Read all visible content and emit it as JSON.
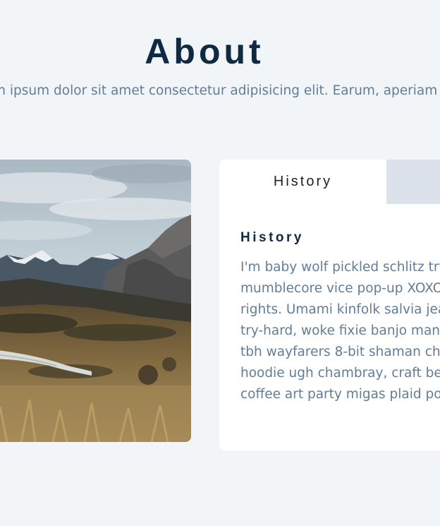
{
  "section": {
    "title": "About",
    "subtitle": "m ipsum dolor sit amet consectetur adipisicing elit. Earum, aperiam"
  },
  "image": {
    "icon": "mountain-landscape-photo"
  },
  "tabs": [
    {
      "label": "History",
      "active": true
    },
    {
      "label": "",
      "active": false
    }
  ],
  "content": {
    "title": "History",
    "lines": [
      "I'm baby wolf pickled schlitz try",
      "mumblecore vice pop-up XOXO",
      "rights. Umami kinfolk salvia jea",
      "try-hard, woke fixie banjo man",
      "tbh wayfarers 8-bit shaman ch",
      "hoodie ugh chambray, craft be",
      "coffee art party migas plaid po"
    ]
  },
  "colors": {
    "background": "#f1f5f8",
    "heading": "#102a42",
    "body_text": "#617d98",
    "card": "#ffffff",
    "inactive_tab": "#dce2ec"
  }
}
